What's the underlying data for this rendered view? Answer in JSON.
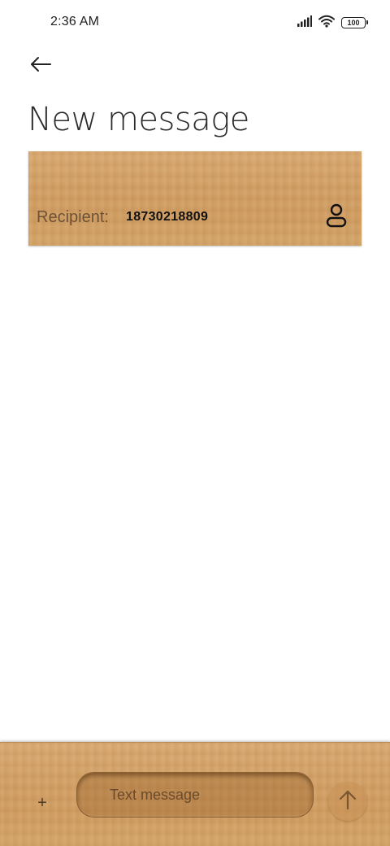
{
  "status_bar": {
    "time": "2:36 AM",
    "battery_level": "100",
    "icons": [
      "signal-icon",
      "wifi-icon",
      "battery-icon"
    ]
  },
  "header": {
    "back_icon": "arrow-left-icon",
    "title": "New message"
  },
  "recipient": {
    "label": "Recipient:",
    "value": "18730218809",
    "contact_icon": "person-icon"
  },
  "composer": {
    "attach_label": "+",
    "placeholder": "Text message",
    "send_icon": "arrow-up-icon"
  },
  "colors": {
    "wood": "#d4a46c",
    "text_dark": "#222222",
    "label_brown": "#6e5236"
  }
}
